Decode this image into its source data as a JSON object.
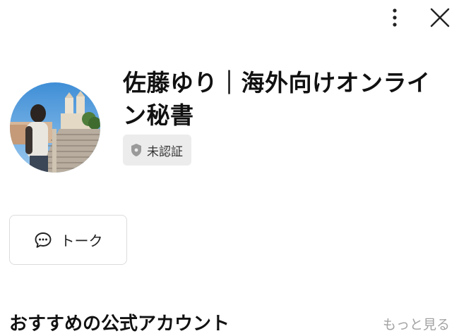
{
  "header": {
    "more_icon": "vertical-ellipsis",
    "close_icon": "close-x"
  },
  "profile": {
    "name": "佐藤ゆり｜海外向けオンライン秘書",
    "badge_icon": "shield-icon",
    "badge_label": "未認証",
    "avatar": "profile-photo"
  },
  "actions": {
    "talk_icon": "chat-bubble-icon",
    "talk_label": "トーク"
  },
  "recommended": {
    "title": "おすすめの公式アカウント",
    "more_label": "もっと見る"
  },
  "colors": {
    "badge_bg": "#ececec",
    "muted_text": "#a3a3a3",
    "border": "#dcdcdc"
  }
}
